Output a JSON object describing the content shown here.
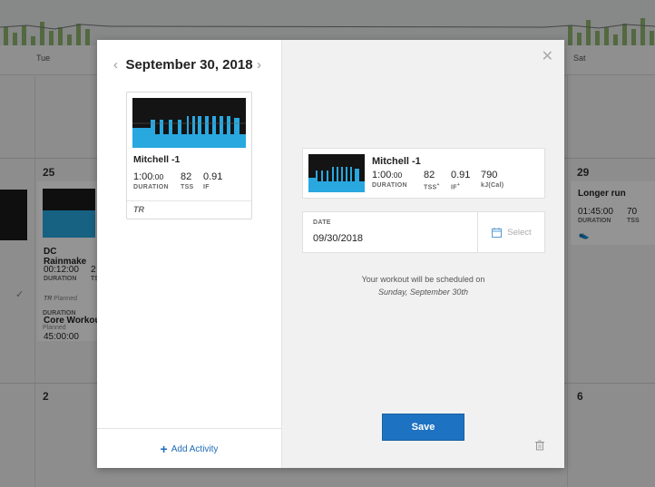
{
  "calendar": {
    "days": [
      "Tue",
      "Sat"
    ],
    "dates": [
      "25",
      "29",
      "2",
      "6"
    ],
    "workout_1": {
      "title": "DC Rainmake",
      "stat1": "00:12:00",
      "stat1_label": "DURATION",
      "stat2": "2",
      "stat2_label": "TS",
      "status": "Planned"
    },
    "workout_2": {
      "title": "Core Workou",
      "stat1": "45:00:00",
      "stat1_label": "DURATION",
      "status": "Planned"
    },
    "workout_3": {
      "title": "Longer run",
      "stat1": "01:45:00",
      "stat1_label": "DURATION",
      "stat2": "70",
      "stat2_label": "TSS"
    }
  },
  "left_panel": {
    "date_title": "September 30, 2018",
    "prev_icon": "chevron-left-icon",
    "next_icon": "chevron-right-icon",
    "workout": {
      "title": "Mitchell -1",
      "duration_main": "1:00",
      "duration_sec": ":00",
      "duration_label": "DURATION",
      "tss": "82",
      "tss_label": "TSS",
      "if_value": "0.91",
      "if_label": "IF",
      "source_logo": "TR"
    },
    "add_activity": "Add Activity"
  },
  "right_panel": {
    "selected": {
      "title": "Mitchell -1",
      "duration_main": "1:00",
      "duration_sec": ":00",
      "duration_label": "DURATION",
      "tss": "82",
      "tss_label": "TSS",
      "tss_sup": "+",
      "if_value": "0.91",
      "if_label": "IF",
      "if_sup": "+",
      "kj": "790",
      "kj_label": "kJ(Cal)"
    },
    "date_label": "DATE",
    "date_value": "09/30/2018",
    "select_label": "Select",
    "schedule_line1": "Your workout will be scheduled on",
    "schedule_line2": "Sunday, September 30th",
    "save_label": "Save"
  },
  "colors": {
    "accent": "#1e72c2",
    "workout_blue": "#29a8e0",
    "link": "#1e6bb8"
  }
}
